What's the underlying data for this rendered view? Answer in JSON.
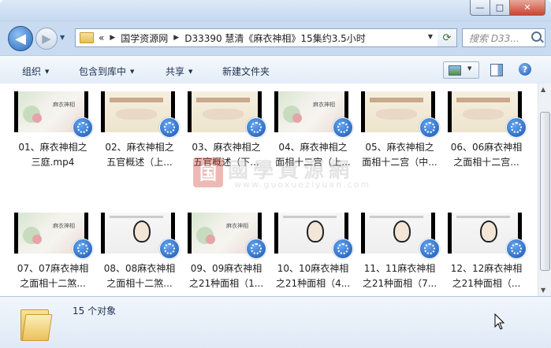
{
  "window": {
    "buttons": {
      "minimize": "—",
      "maximize": "□",
      "close": "✕"
    }
  },
  "nav": {
    "back_icon": "◀",
    "forward_icon": "▶",
    "address": {
      "overflow": "«",
      "crumbs": [
        "国学资源网",
        "D33390 慧清《麻衣神相》15集约3.5小时"
      ]
    },
    "refresh_icon": "⟳",
    "search_placeholder": "搜索 D33..."
  },
  "toolbar": {
    "organize": "组织",
    "include_in_library": "包含到库中",
    "share": "共享",
    "new_folder": "新建文件夹"
  },
  "files": [
    {
      "label": "01、麻衣神相之\n三庭.mp4",
      "thumb": "t1"
    },
    {
      "label": "02、麻衣神相之\n五官概述（上...",
      "thumb": "t2"
    },
    {
      "label": "03、麻衣神相之\n五官概述（下...",
      "thumb": "t2"
    },
    {
      "label": "04、麻衣神相之\n面相十二宫（上...",
      "thumb": "t1"
    },
    {
      "label": "05、麻衣神相之\n面相十二宫（中...",
      "thumb": "t2"
    },
    {
      "label": "06、06麻衣神相\n之面相十二宫...",
      "thumb": "t2"
    },
    {
      "label": "07、07麻衣神相\n之面相十二煞...",
      "thumb": "t1"
    },
    {
      "label": "08、08麻衣神相\n之面相十二煞...",
      "thumb": "t3"
    },
    {
      "label": "09、09麻衣神相\n之21种面相（1...",
      "thumb": "t1"
    },
    {
      "label": "10、10麻衣神相\n之21种面相（4...",
      "thumb": "t3"
    },
    {
      "label": "11、11麻衣神相\n之21种面相（7...",
      "thumb": "t3"
    },
    {
      "label": "12、12麻衣神相\n之21种面相（...",
      "thumb": "t3"
    }
  ],
  "watermark": {
    "seal": "国",
    "chinese": "國學資源網",
    "url": "www.guoxueziyuan.com"
  },
  "status": {
    "count": "15 个对象"
  }
}
